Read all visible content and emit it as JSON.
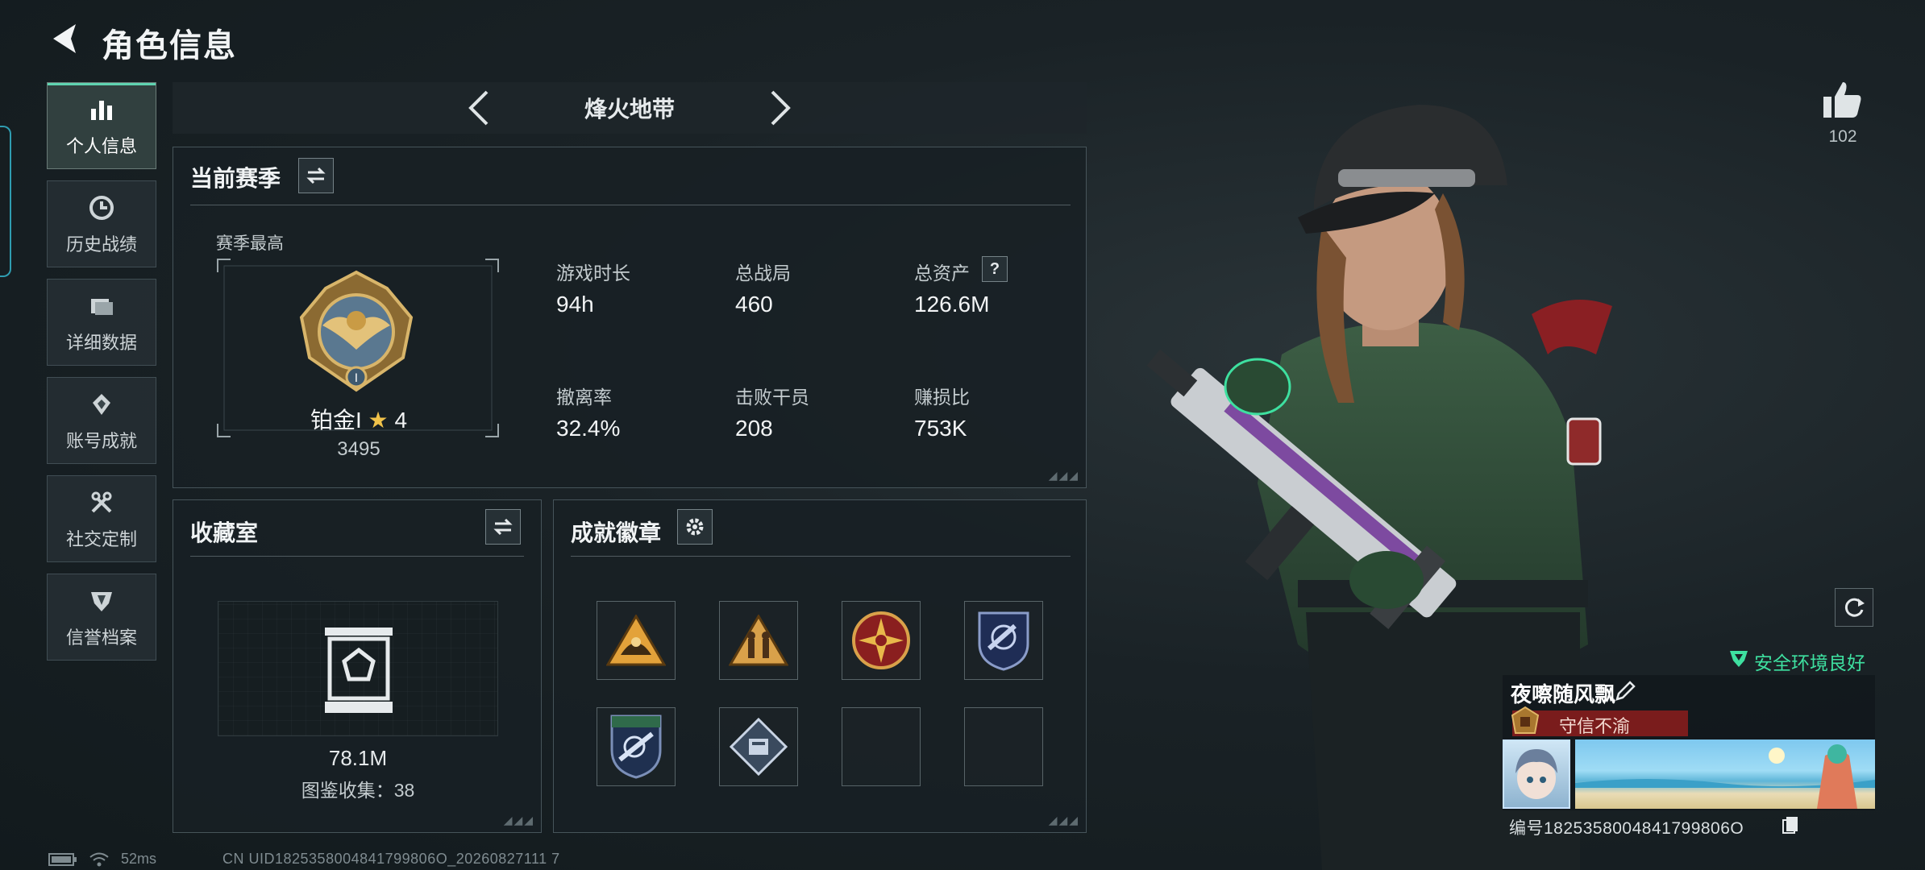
{
  "header": {
    "title": "角色信息"
  },
  "nav": {
    "items": [
      {
        "label": "个人信息",
        "icon": "bar-chart-icon",
        "active": true
      },
      {
        "label": "历史战绩",
        "icon": "clock-icon",
        "active": false
      },
      {
        "label": "详细数据",
        "icon": "folder-icon",
        "active": false
      },
      {
        "label": "账号成就",
        "icon": "medal-icon",
        "active": false
      },
      {
        "label": "社交定制",
        "icon": "wrench-icon",
        "active": false
      },
      {
        "label": "信誉档案",
        "icon": "shield-icon",
        "active": false
      }
    ]
  },
  "mode": {
    "title": "烽火地带"
  },
  "season": {
    "title": "当前赛季",
    "best_label": "赛季最高",
    "rank_name": "铂金I",
    "rank_stars": "4",
    "rank_score": "3495",
    "stats": [
      {
        "label": "游戏时长",
        "value": "94h"
      },
      {
        "label": "总战局",
        "value": "460"
      },
      {
        "label": "总资产",
        "value": "126.6M"
      },
      {
        "label": "撤离率",
        "value": "32.4%"
      },
      {
        "label": "击败干员",
        "value": "208"
      },
      {
        "label": "赚损比",
        "value": "753K"
      }
    ],
    "help_mark": "?"
  },
  "collection": {
    "title": "收藏室",
    "value": "78.1M",
    "catalog": "图鉴收集：38"
  },
  "badges": {
    "title": "成就徽章",
    "slots": [
      {
        "icon": "triangle-hill-badge-icon",
        "filled": true
      },
      {
        "icon": "triangle-figures-badge-icon",
        "filled": true
      },
      {
        "icon": "red-cross-emblem-badge-icon",
        "filled": true
      },
      {
        "icon": "blue-shield-badge-icon",
        "filled": true
      },
      {
        "icon": "green-shield-badge-icon",
        "filled": true
      },
      {
        "icon": "diamond-crate-badge-icon",
        "filled": true
      },
      {
        "icon": "",
        "filled": false
      },
      {
        "icon": "",
        "filled": false
      }
    ]
  },
  "profile": {
    "likes": "102",
    "safe_status": "安全环境良好",
    "name": "夜嚓随风飘",
    "title": "守信不渝",
    "uid_line": "编号1825358004841799806O"
  },
  "status": {
    "ping": "52ms",
    "uid": "CN UID1825358004841799806O_20260827111 7"
  },
  "colors": {
    "accent": "#5fd3b0",
    "safe": "#3ee0a0",
    "title_red": "#7a1c1c"
  }
}
